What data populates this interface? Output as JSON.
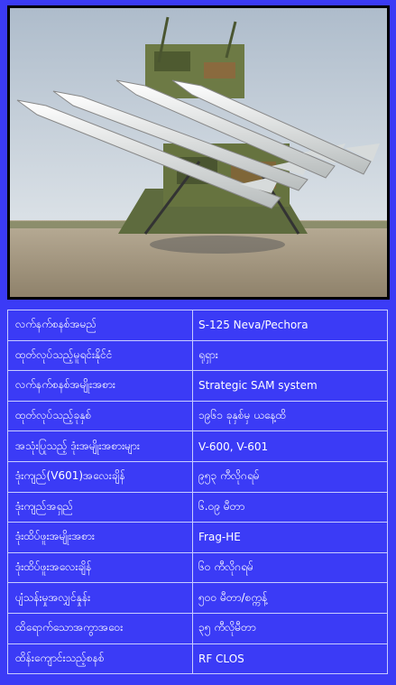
{
  "photo": {
    "subject": "s125-missile-launcher-photo",
    "colors": {
      "sky": "#c9d3dc",
      "ground": "#b3a58f",
      "missile": "#e9ecec",
      "launcher": "#5e6b3e"
    }
  },
  "specs": [
    {
      "label": "လက်နက်စနစ်အမည်",
      "value": "S-125 Neva/Pechora"
    },
    {
      "label": "ထုတ်လုပ်သည့်မူရင်းနိုင်ငံ",
      "value": "ရုရှား"
    },
    {
      "label": "လက်နက်စနစ်အမျိုးအစား",
      "value": "Strategic SAM system"
    },
    {
      "label": "ထုတ်လုပ်သည့်ခုနှစ်",
      "value": "၁၉၆၁ ခုနှစ်မှ ယနေ့ထိ"
    },
    {
      "label": "အသုံးပြုသည့် ဒုံးအမျိုးအစားများ",
      "value": "V-600, V-601"
    },
    {
      "label": "ဒုံးကျည်(V601)အလေးချိန်",
      "value": "၉၅၃ ကီလိုဂရမ်"
    },
    {
      "label": "ဒုံးကျည်အရှည်",
      "value": "၆.၀၉ မီတာ"
    },
    {
      "label": "ဒုံးထိပ်ဖူးအမျိုးအစား",
      "value": "Frag-HE"
    },
    {
      "label": "ဒုံးထိပ်ဖူးအလေးချိန်",
      "value": "၆၀ ကီလိုဂရမ်"
    },
    {
      "label": "ပျံသန်းမှုအလျှင်နှုန်း",
      "value": "၅၀၀ မီတာ/စက္ကန့်"
    },
    {
      "label": "ထိရောက်သောအကွာအဝေး",
      "value": "၃၅ ကီလိုမီတာ"
    },
    {
      "label": "ထိန်းကျောင်းသည့်စနစ်",
      "value": "RF CLOS"
    }
  ]
}
